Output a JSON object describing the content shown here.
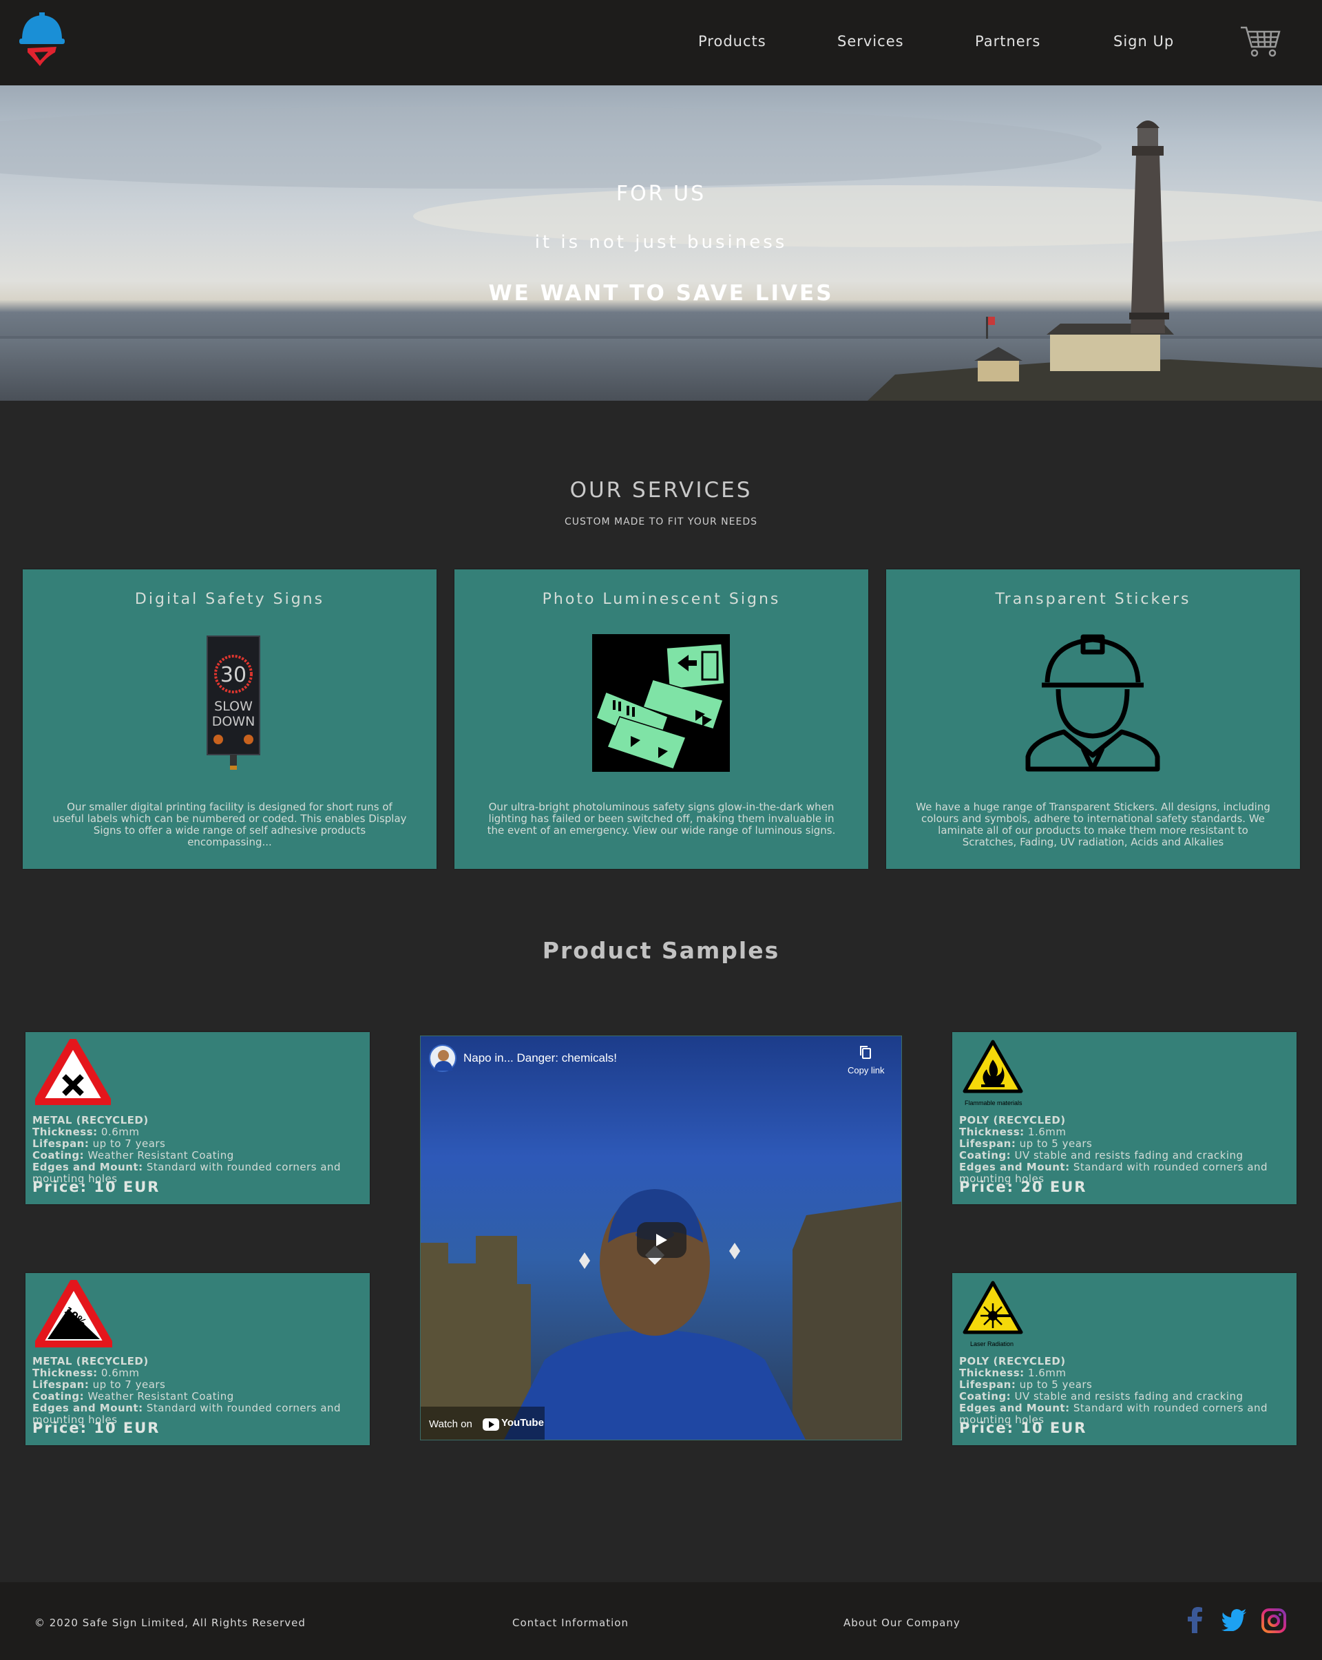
{
  "nav": {
    "logo_icon": "hardhat-shield-logo-icon",
    "links": [
      "Products",
      "Services",
      "Partners",
      "Sign Up"
    ],
    "cart_icon": "shopping-cart-icon"
  },
  "hero": {
    "line1": "FOR US",
    "line2": "it is not just business",
    "line3": "WE WANT TO SAVE LIVES"
  },
  "services": {
    "title": "OUR SERVICES",
    "subtitle": "CUSTOM MADE TO FIT YOUR NEEDS",
    "cards": [
      {
        "title": "Digital Safety Signs",
        "image": "digital-speed-sign-image",
        "sign_number": "30",
        "sign_text1": "SLOW",
        "sign_text2": "DOWN",
        "text": "Our smaller digital printing facility is designed for short runs of useful labels which can be numbered or coded. This enables Display Signs to offer a wide range of self adhesive products encompassing..."
      },
      {
        "title": "Photo Luminescent Signs",
        "image": "glowing-exit-signs-image",
        "text": "Our ultra-bright photoluminous safety signs glow-in-the-dark when lighting has failed or been switched off, making them invaluable in the event of an emergency. View our wide range of luminous signs."
      },
      {
        "title": "Transparent Stickers",
        "image": "construction-worker-icon",
        "text": "We have a huge range of Transparent Stickers. All designs, including colours and symbols, adhere to international safety standards. We laminate all of our products to make them more resistant to Scratches, Fading, UV radiation, Acids and Alkalies"
      }
    ]
  },
  "products": {
    "title": "Product Samples",
    "items": [
      {
        "icon": "crossroads-warning-sign-icon",
        "material": "METAL (RECYCLED)",
        "thickness": "0.6mm",
        "lifespan": "up to 7 years",
        "coating": "Weather Resistant Coating",
        "edges": "Standard with rounded corners and mounting holes",
        "price": "Price: 10 EUR"
      },
      {
        "icon": "flammable-materials-sign-icon",
        "caption": "Flammable materials",
        "material": "POLY (RECYCLED)",
        "thickness": "1.6mm",
        "lifespan": "up to 5 years",
        "coating": "UV stable and resists fading and cracking",
        "edges": "Standard with rounded corners and mounting holes",
        "price": "Price: 20 EUR"
      },
      {
        "icon": "steep-descent-sign-icon",
        "grade": "10%",
        "material": "METAL (RECYCLED)",
        "thickness": "0.6mm",
        "lifespan": "up to 7 years",
        "coating": "Weather Resistant Coating",
        "edges": "Standard with rounded corners and mounting holes",
        "price": "Price: 10 EUR"
      },
      {
        "icon": "laser-radiation-sign-icon",
        "caption": "Laser Radiation",
        "material": "POLY (RECYCLED)",
        "thickness": "1.6mm",
        "lifespan": "up to 5 years",
        "coating": "UV stable and resists fading and cracking",
        "edges": "Standard with rounded corners and mounting holes",
        "price": "Price: 10 EUR"
      }
    ],
    "labels": {
      "thickness": "Thickness:",
      "lifespan": "Lifespan:",
      "coating": "Coating:",
      "edges": "Edges and Mount:"
    }
  },
  "video": {
    "title": "Napo in... Danger: chemicals!",
    "copy_link": "Copy link",
    "watch_on": "Watch on",
    "youtube": "YouTube"
  },
  "footer": {
    "copyright": "© 2020 Safe Sign Limited, All Rights Reserved",
    "contact": "Contact Information",
    "about": "About Our Company",
    "social": [
      "facebook-icon",
      "twitter-icon",
      "instagram-icon"
    ]
  }
}
